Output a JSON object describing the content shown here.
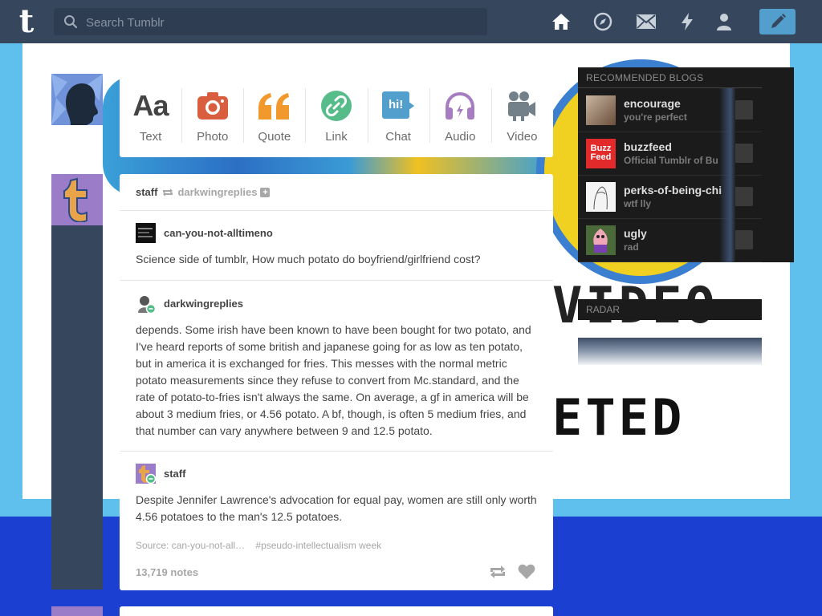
{
  "header": {
    "logo": "t",
    "search_placeholder": "Search Tumblr",
    "nav_icons": [
      "home-icon",
      "explore-icon",
      "inbox-icon",
      "activity-icon",
      "account-icon"
    ],
    "compose_icon": "pencil-icon"
  },
  "post_types": [
    {
      "label": "Text",
      "glyph": "Aa",
      "color": "#444444"
    },
    {
      "label": "Photo",
      "color": "#d95e40"
    },
    {
      "label": "Quote",
      "color": "#f2992e"
    },
    {
      "label": "Link",
      "color": "#56bc8a"
    },
    {
      "label": "Chat",
      "glyph": "hi!",
      "color": "#529ecc"
    },
    {
      "label": "Audio",
      "color": "#a77dc2"
    },
    {
      "label": "Video",
      "color": "#748089"
    }
  ],
  "post": {
    "author": "staff",
    "reblogged_from": "darkwingreplies",
    "entries": [
      {
        "username": "can-you-not-alltimeno",
        "text": "Science side of tumblr, How much potato do boyfriend/girlfriend cost?"
      },
      {
        "username": "darkwingreplies",
        "text": "depends. Some irish have been known to have been bought for two potato, and I've heard reports of some british and japanese going for as low as ten potato, but in america it is exchanged for fries. This messes with the normal metric potato measurements since they refuse to convert from Mc.standard, and the rate of potato-to-fries isn't always the same. On average, a gf in america will be about 3 medium fries, or 4.56 potato. A bf, though, is often 5 medium fries, and that number can vary anywhere between 9 and 12.5 potato."
      },
      {
        "username": "staff",
        "text": "Despite Jennifer Lawrence's advocation for equal pay, women are still only worth 4.56 potatoes to the man's 12.5 potatoes."
      }
    ],
    "source": "Source: can-you-not-all…",
    "tag": "#pseudo-intellectualism week",
    "notes": "13,719 notes"
  },
  "sidebar": {
    "recommended_title": "RECOMMENDED BLOGS",
    "blogs": [
      {
        "name": "encourage",
        "subtitle": "you're perfect"
      },
      {
        "name": "buzzfeed",
        "subtitle": "Official Tumblr of Bu",
        "logo_text": "Buzz\nFeed"
      },
      {
        "name": "perks-of-being-chi",
        "subtitle": "wtf lly"
      },
      {
        "name": "ugly",
        "subtitle": "rad"
      }
    ],
    "radar_title": "RADAR"
  },
  "background_text": [
    "VIDEO",
    "ETED"
  ],
  "colors": {
    "header": "#36465d",
    "accent": "#529ecc",
    "page_bg": "#1b3fd1"
  }
}
